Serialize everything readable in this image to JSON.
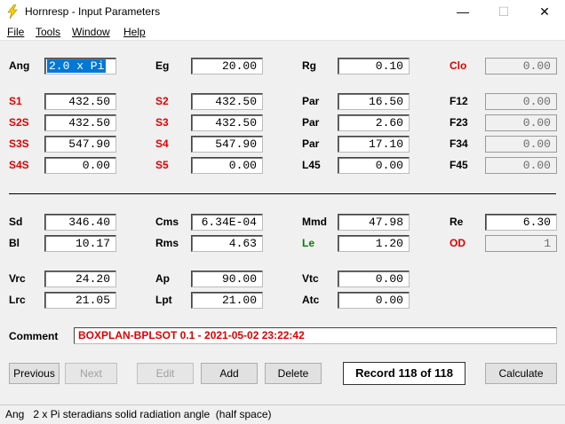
{
  "window": {
    "title": "Hornresp - Input Parameters",
    "controls": {
      "minimize": "—",
      "maximize": "☐",
      "close": "✕"
    }
  },
  "menu": [
    {
      "label": "File"
    },
    {
      "label": "Tools"
    },
    {
      "label": "Window"
    },
    {
      "label": "Help"
    }
  ],
  "params": {
    "ang": {
      "label": "Ang",
      "value": "2.0 x Pi"
    },
    "eg": {
      "label": "Eg",
      "value": "20.00"
    },
    "rg": {
      "label": "Rg",
      "value": "0.10"
    },
    "clo": {
      "label": "Clo",
      "value": "0.00"
    },
    "s1": {
      "label": "S1",
      "value": "432.50"
    },
    "s2": {
      "label": "S2",
      "value": "432.50"
    },
    "par1": {
      "label": "Par",
      "value": "16.50"
    },
    "f12": {
      "label": "F12",
      "value": "0.00"
    },
    "s2s": {
      "label": "S2S",
      "value": "432.50"
    },
    "s3": {
      "label": "S3",
      "value": "432.50"
    },
    "par2": {
      "label": "Par",
      "value": "2.60"
    },
    "f23": {
      "label": "F23",
      "value": "0.00"
    },
    "s3s": {
      "label": "S3S",
      "value": "547.90"
    },
    "s4": {
      "label": "S4",
      "value": "547.90"
    },
    "par3": {
      "label": "Par",
      "value": "17.10"
    },
    "f34": {
      "label": "F34",
      "value": "0.00"
    },
    "s4s": {
      "label": "S4S",
      "value": "0.00"
    },
    "s5": {
      "label": "S5",
      "value": "0.00"
    },
    "l45": {
      "label": "L45",
      "value": "0.00"
    },
    "f45": {
      "label": "F45",
      "value": "0.00"
    },
    "sd": {
      "label": "Sd",
      "value": "346.40"
    },
    "cms": {
      "label": "Cms",
      "value": "6.34E-04"
    },
    "mmd": {
      "label": "Mmd",
      "value": "47.98"
    },
    "re": {
      "label": "Re",
      "value": "6.30"
    },
    "bl": {
      "label": "Bl",
      "value": "10.17"
    },
    "rms": {
      "label": "Rms",
      "value": "4.63"
    },
    "le": {
      "label": "Le",
      "value": "1.20"
    },
    "od": {
      "label": "OD",
      "value": "1"
    },
    "vrc": {
      "label": "Vrc",
      "value": "24.20"
    },
    "ap": {
      "label": "Ap",
      "value": "90.00"
    },
    "vtc": {
      "label": "Vtc",
      "value": "0.00"
    },
    "lrc": {
      "label": "Lrc",
      "value": "21.05"
    },
    "lpt": {
      "label": "Lpt",
      "value": "21.00"
    },
    "atc": {
      "label": "Atc",
      "value": "0.00"
    }
  },
  "comment": {
    "label": "Comment",
    "value": "BOXPLAN-BPLSOT 0.1 - 2021-05-02 23:22:42"
  },
  "buttons": {
    "previous": "Previous",
    "next": "Next",
    "edit": "Edit",
    "add": "Add",
    "delete": "Delete",
    "calculate": "Calculate"
  },
  "record": "Record 118 of 118",
  "status": "Ang   2 x Pi steradians solid radiation angle  (half space)",
  "colors": {
    "red_label": "#e00000",
    "green_label": "#008000",
    "selection": "#0078d7"
  },
  "icons": {
    "app": "lightning-bolt-icon"
  }
}
